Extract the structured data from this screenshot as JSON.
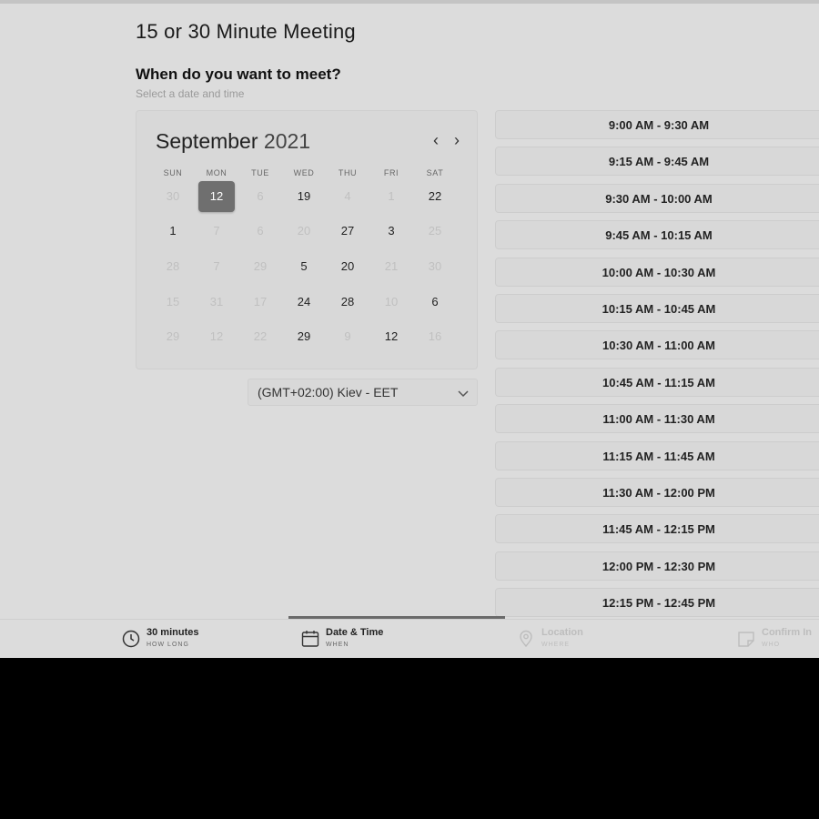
{
  "page": {
    "title": "15 or 30 Minute Meeting",
    "question": "When do you want to meet?",
    "subtitle": "Select a date and time"
  },
  "calendar": {
    "month": "September",
    "year": "2021",
    "prev_icon": "‹",
    "next_icon": "›",
    "weekdays": [
      "SUN",
      "MON",
      "TUE",
      "WED",
      "THU",
      "FRI",
      "SAT"
    ],
    "rows": [
      [
        {
          "d": "30",
          "m": true
        },
        {
          "d": "12",
          "sel": true
        },
        {
          "d": "6",
          "m": true
        },
        {
          "d": "19"
        },
        {
          "d": "4",
          "m": true
        },
        {
          "d": "1",
          "m": true
        },
        {
          "d": "22"
        }
      ],
      [
        {
          "d": "1"
        },
        {
          "d": "7",
          "m": true
        },
        {
          "d": "6",
          "m": true
        },
        {
          "d": "20",
          "m": true
        },
        {
          "d": "27"
        },
        {
          "d": "3"
        },
        {
          "d": "25",
          "m": true
        }
      ],
      [
        {
          "d": "28",
          "m": true
        },
        {
          "d": "7",
          "m": true
        },
        {
          "d": "29",
          "m": true
        },
        {
          "d": "5"
        },
        {
          "d": "20"
        },
        {
          "d": "21",
          "m": true
        },
        {
          "d": "30",
          "m": true
        }
      ],
      [
        {
          "d": "15",
          "m": true
        },
        {
          "d": "31",
          "m": true
        },
        {
          "d": "17",
          "m": true
        },
        {
          "d": "24"
        },
        {
          "d": "28"
        },
        {
          "d": "10",
          "m": true
        },
        {
          "d": "6"
        }
      ],
      [
        {
          "d": "29",
          "m": true
        },
        {
          "d": "12",
          "m": true
        },
        {
          "d": "22",
          "m": true
        },
        {
          "d": "29"
        },
        {
          "d": "9",
          "m": true
        },
        {
          "d": "12"
        },
        {
          "d": "16",
          "m": true
        }
      ]
    ]
  },
  "timezone": {
    "label": "(GMT+02:00) Kiev - EET",
    "icon": "chevron-down-icon"
  },
  "slots": [
    "9:00 AM - 9:30 AM",
    "9:15 AM - 9:45 AM",
    "9:30 AM - 10:00 AM",
    "9:45 AM - 10:15 AM",
    "10:00 AM - 10:30 AM",
    "10:15 AM - 10:45 AM",
    "10:30 AM - 11:00 AM",
    "10:45 AM - 11:15 AM",
    "11:00 AM - 11:30 AM",
    "11:15 AM - 11:45 AM",
    "11:30 AM - 12:00 PM",
    "11:45 AM - 12:15 PM",
    "12:00 PM - 12:30 PM",
    "12:15 PM - 12:45 PM"
  ],
  "steps": [
    {
      "label": "30 minutes",
      "sub": "HOW LONG",
      "icon": "clock-icon",
      "active": true
    },
    {
      "label": "Date & Time",
      "sub": "WHEN",
      "icon": "calendar-icon",
      "active": true
    },
    {
      "label": "Location",
      "sub": "WHERE",
      "icon": "location-pin-icon",
      "active": false
    },
    {
      "label": "Confirm In",
      "sub": "WHO",
      "icon": "note-icon",
      "active": false
    }
  ]
}
